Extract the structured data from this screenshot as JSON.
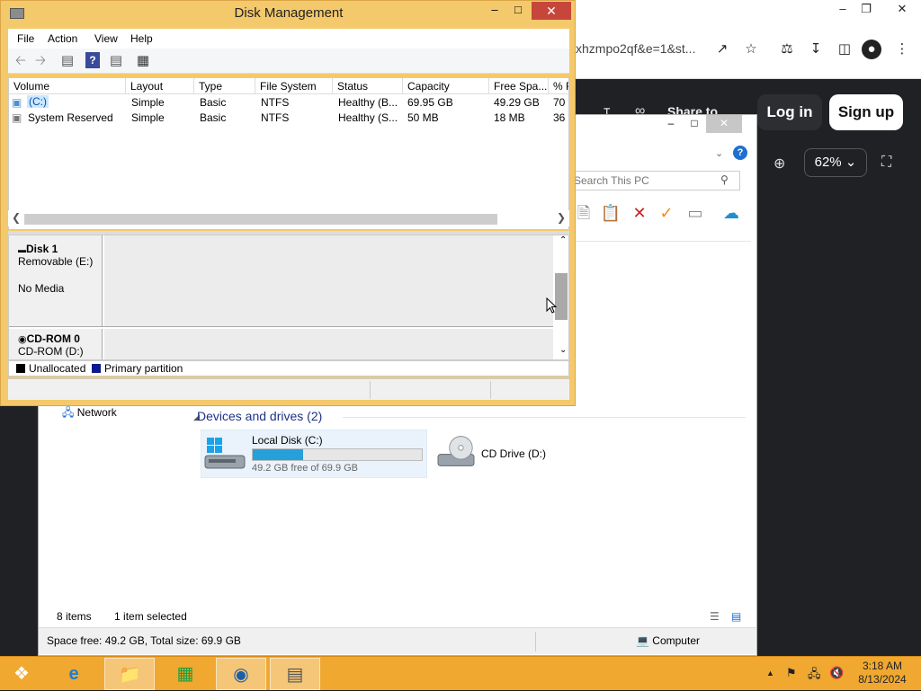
{
  "browser": {
    "url_fragment": "xhzmpo2qf&e=1&st...",
    "share_label": "Share to",
    "login_label": "Log in",
    "signup_label": "Sign up",
    "zoom_level": "62%"
  },
  "explorer": {
    "search_placeholder": "Search This PC",
    "network_label": "Network",
    "devices_header": "Devices and drives (2)",
    "drives": [
      {
        "name": "Local Disk (C:)",
        "free_text": "49.2 GB free of 69.9 GB",
        "used_fraction": 0.3
      },
      {
        "name": "CD Drive (D:)"
      }
    ],
    "item_count": "8 items",
    "selection": "1 item selected",
    "info_left": "Space free: 49.2 GB, Total size: 69.9 GB",
    "info_right": "Computer"
  },
  "disk_management": {
    "title": "Disk Management",
    "menu": [
      "File",
      "Action",
      "View",
      "Help"
    ],
    "columns": [
      "Volume",
      "Layout",
      "Type",
      "File System",
      "Status",
      "Capacity",
      "Free Spa...",
      "% F"
    ],
    "volumes": [
      {
        "volume": "(C:)",
        "layout": "Simple",
        "type": "Basic",
        "fs": "NTFS",
        "status": "Healthy (B...",
        "capacity": "69.95 GB",
        "free": "49.29 GB",
        "pct": "70"
      },
      {
        "volume": "System Reserved",
        "layout": "Simple",
        "type": "Basic",
        "fs": "NTFS",
        "status": "Healthy (S...",
        "capacity": "50 MB",
        "free": "18 MB",
        "pct": "36"
      }
    ],
    "disks": [
      {
        "name": "Disk 1",
        "type": "Removable (E:)",
        "media": "No Media"
      },
      {
        "name": "CD-ROM 0",
        "type": "CD-ROM (D:)"
      }
    ],
    "legend": [
      {
        "label": "Unallocated",
        "color": "#000000"
      },
      {
        "label": "Primary partition",
        "color": "#0a1a8c"
      }
    ]
  },
  "taskbar": {
    "time": "3:18 AM",
    "date": "8/13/2024"
  }
}
